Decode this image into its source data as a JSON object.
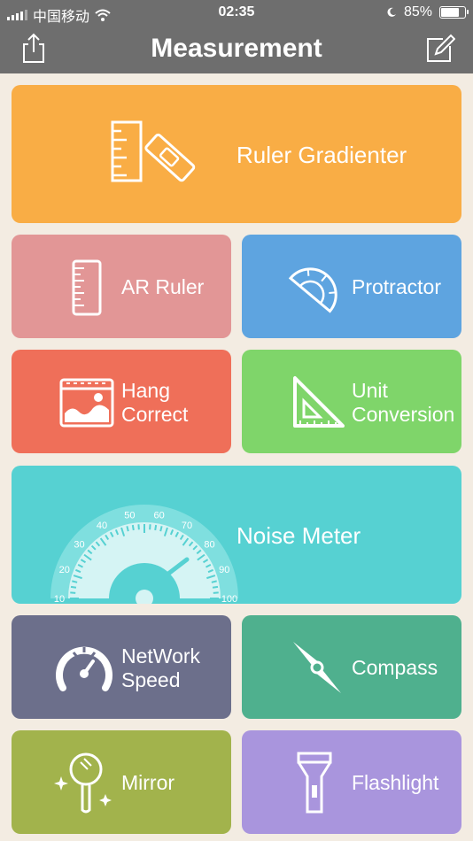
{
  "status": {
    "carrier": "中国移动",
    "time": "02:35",
    "battery": "85%"
  },
  "header": {
    "title": "Measurement",
    "share_icon": "share-icon",
    "edit_icon": "edit-icon"
  },
  "tiles": {
    "ruler_gradienter": {
      "label": "Ruler Gradienter",
      "color": "#f9ad45"
    },
    "ar_ruler": {
      "label": "AR Ruler",
      "color": "#e29696"
    },
    "protractor": {
      "label": "Protractor",
      "color": "#5ea4e0"
    },
    "hang_correct": {
      "line1": "Hang",
      "line2": "Correct",
      "color": "#ef6f59"
    },
    "unit_conversion": {
      "line1": "Unit",
      "line2": "Conversion",
      "color": "#7fd56a"
    },
    "noise_meter": {
      "label": "Noise Meter",
      "color": "#56d1d2",
      "scale": [
        "10",
        "20",
        "30",
        "40",
        "50",
        "60",
        "70",
        "80",
        "90",
        "100"
      ]
    },
    "network_speed": {
      "line1": "NetWork",
      "line2": "Speed",
      "color": "#6c6f8b"
    },
    "compass": {
      "label": "Compass",
      "color": "#4fb08e"
    },
    "mirror": {
      "label": "Mirror",
      "color": "#a2b34c"
    },
    "flashlight": {
      "label": "Flashlight",
      "color": "#a995dd"
    }
  }
}
